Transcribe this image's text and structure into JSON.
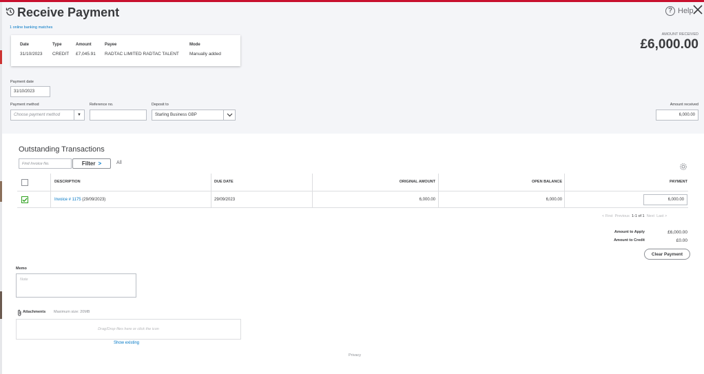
{
  "header": {
    "title": "Receive Payment",
    "help_label": "Help",
    "bank_matches": "1 online banking matches",
    "amount_received_label": "AMOUNT RECEIVED",
    "amount_received_value": "£6,000.00"
  },
  "match_card": {
    "headers": {
      "date": "Date",
      "type": "Type",
      "amount": "Amount",
      "payee": "Payee",
      "mode": "Mode"
    },
    "row": {
      "date": "31/10/2023",
      "type": "CREDIT",
      "amount": "£7,045.91",
      "payee": "RADTAC LIMITED RADTAC TALENT",
      "mode": "Manually added"
    }
  },
  "form": {
    "payment_date_label": "Payment date",
    "payment_date_value": "31/10/2023",
    "payment_method_label": "Payment method",
    "payment_method_placeholder": "Choose payment method",
    "reference_label": "Reference no.",
    "reference_value": "",
    "deposit_to_label": "Deposit to",
    "deposit_to_value": "Starling Business GBP",
    "amount_received_label": "Amount received",
    "amount_received_value": "6,000.00"
  },
  "outstanding": {
    "title": "Outstanding Transactions",
    "find_placeholder": "Find Invoice No.",
    "filter_label": "Filter",
    "all_label": "All",
    "columns": [
      "DESCRIPTION",
      "DUE DATE",
      "ORIGINAL AMOUNT",
      "OPEN BALANCE",
      "PAYMENT"
    ],
    "rows": [
      {
        "checked": true,
        "invoice_link": "Invoice # 1175",
        "invoice_date": "(29/09/2023)",
        "due_date": "29/09/2023",
        "original_amount": "6,000.00",
        "open_balance": "6,000.00",
        "payment": "6,000.00"
      }
    ],
    "pager": {
      "first": "< First",
      "previous": "Previous",
      "range": "1-1 of 1",
      "next": "Next",
      "last": "Last >"
    }
  },
  "totals": {
    "apply_label": "Amount to Apply",
    "apply_value": "£6,000.00",
    "credit_label": "Amount to Credit",
    "credit_value": "£0.00",
    "clear_label": "Clear Payment"
  },
  "memo": {
    "label": "Memo",
    "placeholder": "Note"
  },
  "attachments": {
    "label": "Attachments",
    "max_size": "Maximum size: 20MB",
    "drop_text": "Drag/Drop files here or click the icon",
    "show_existing": "Show existing"
  },
  "footer": {
    "privacy": "Privacy"
  },
  "colors": {
    "accent_link": "#0077c5",
    "check_green": "#2ca01c",
    "header_bg": "#f4f5f8",
    "top_bar": "#c8102e"
  }
}
